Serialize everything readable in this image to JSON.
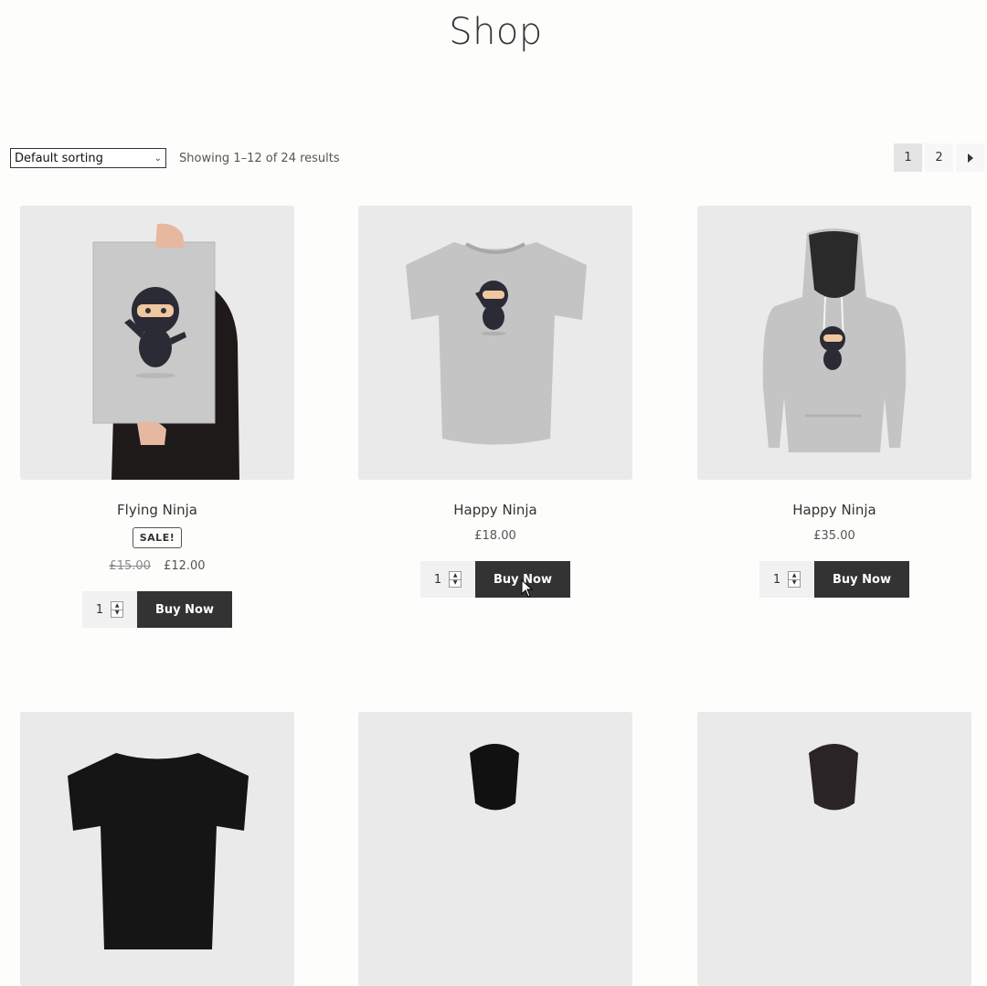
{
  "page": {
    "title": "Shop"
  },
  "toolbar": {
    "sort_selected": "Default sorting",
    "results_text": "Showing 1–12 of 24 results"
  },
  "pagination": {
    "pages": [
      "1",
      "2"
    ],
    "current": "1",
    "next_icon": "chevron-right-icon"
  },
  "products": [
    {
      "name": "Flying Ninja",
      "sale_badge": "SALE!",
      "old_price": "£15.00",
      "price": "£12.00",
      "qty": "1",
      "button": "Buy Now",
      "image": "poster-ninja"
    },
    {
      "name": "Happy Ninja",
      "price": "£18.00",
      "qty": "1",
      "button": "Buy Now",
      "image": "tshirt-ninja"
    },
    {
      "name": "Happy Ninja",
      "price": "£35.00",
      "qty": "1",
      "button": "Buy Now",
      "image": "hoodie-ninja"
    }
  ],
  "colors": {
    "button_bg": "#333333",
    "button_text": "#ffffff",
    "thumb_bg": "#eaeaea"
  }
}
